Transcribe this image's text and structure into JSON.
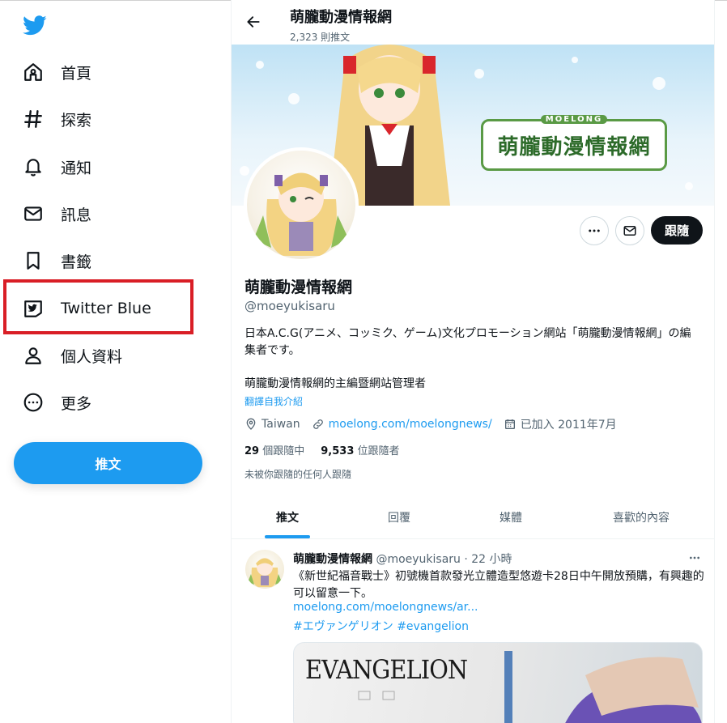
{
  "sidebar": {
    "logo": "twitter-bird-icon",
    "items": [
      {
        "label": "首頁",
        "icon": "home-icon"
      },
      {
        "label": "探索",
        "icon": "hashtag-icon"
      },
      {
        "label": "通知",
        "icon": "bell-icon"
      },
      {
        "label": "訊息",
        "icon": "envelope-icon"
      },
      {
        "label": "書籤",
        "icon": "bookmark-icon"
      },
      {
        "label": "Twitter Blue",
        "icon": "twitter-blue-icon"
      },
      {
        "label": "個人資料",
        "icon": "person-icon"
      },
      {
        "label": "更多",
        "icon": "more-circle-icon"
      }
    ],
    "tweet_button": "推文"
  },
  "header": {
    "title": "萌朧動漫情報網",
    "tweet_count": "2,323 則推文"
  },
  "banner": {
    "logo_text": "萌朧動漫情報網",
    "logo_small": "MOELONG"
  },
  "profile": {
    "name": "萌朧動漫情報網",
    "handle": "@moeyukisaru",
    "bio_line1": "日本A.C.G(アニメ、コッミク、ゲーム)文化プロモーション網站「萌朧動漫情報網」の編集者です。",
    "bio_line2": "萌朧動漫情報網的主編暨網站管理者",
    "translate": "翻譯自我介紹",
    "location": "Taiwan",
    "website": "moelong.com/moelongnews/",
    "joined": "已加入 2011年7月",
    "following_count": "29",
    "following_label": "個跟隨中",
    "followers_count": "9,533",
    "followers_label": "位跟隨者",
    "not_followed": "未被你跟隨的任何人跟隨",
    "follow_button": "跟隨"
  },
  "tabs": [
    "推文",
    "回覆",
    "媒體",
    "喜歡的內容"
  ],
  "tweet": {
    "name": "萌朧動漫情報網",
    "handle_time": "@moeyukisaru · 22 小時",
    "text": "《新世紀福音戰士》初號機首款發光立體造型悠遊卡28日中午開放預購，有興趣的可以留意一下。",
    "link": "moelong.com/moelongnews/ar...",
    "hashtag1": "#エヴァンゲリオン",
    "hashtag2": "#evangelion",
    "media_text": "EVANGELION"
  },
  "colors": {
    "accent": "#1d9bf0",
    "highlight": "#d91e26",
    "text": "#0f1419",
    "secondary": "#536471"
  }
}
